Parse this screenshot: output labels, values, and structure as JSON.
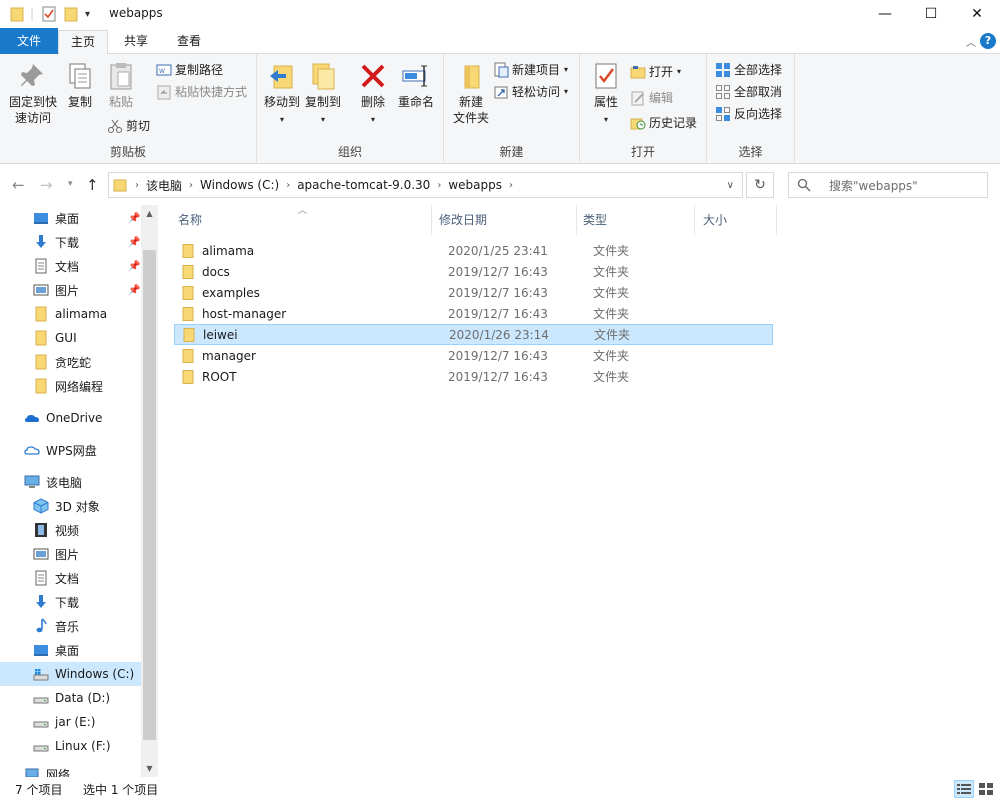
{
  "window": {
    "title": "webapps",
    "minimize": "—",
    "maximize": "☐",
    "close": "✕"
  },
  "ribbon_tabs": {
    "file": "文件",
    "home": "主页",
    "share": "共享",
    "view": "查看",
    "help": "?"
  },
  "clipboard": {
    "pin": "固定到快\n速访问",
    "pin_line1": "固定到快",
    "pin_line2": "速访问",
    "copy": "复制",
    "paste": "粘贴",
    "copy_path": "复制路径",
    "paste_shortcut": "粘贴快捷方式",
    "cut": "剪切",
    "label": "剪贴板"
  },
  "organize": {
    "move_to": "移动到",
    "copy_to": "复制到",
    "delete": "删除",
    "rename": "重命名",
    "label": "组织"
  },
  "new_group": {
    "new_folder_line1": "新建",
    "new_folder_line2": "文件夹",
    "new_item": "新建项目",
    "easy_access": "轻松访问",
    "label": "新建"
  },
  "open_group": {
    "properties": "属性",
    "open": "打开",
    "edit": "编辑",
    "history": "历史记录",
    "label": "打开"
  },
  "select_group": {
    "select_all": "全部选择",
    "select_none": "全部取消",
    "invert": "反向选择",
    "label": "选择"
  },
  "address": {
    "crumbs": [
      "该电脑",
      "Windows (C:)",
      "apache-tomcat-9.0.30",
      "webapps"
    ],
    "search_placeholder": "搜索\"webapps\""
  },
  "nav": {
    "quick": [
      {
        "label": "桌面",
        "pinned": true
      },
      {
        "label": "下载",
        "pinned": true
      },
      {
        "label": "文档",
        "pinned": true
      },
      {
        "label": "图片",
        "pinned": true
      },
      {
        "label": "alimama"
      },
      {
        "label": "GUI"
      },
      {
        "label": "贪吃蛇"
      },
      {
        "label": "网络编程"
      }
    ],
    "onedrive": "OneDrive",
    "wps": "WPS网盘",
    "this_pc": "该电脑",
    "pc_items": [
      "3D 对象",
      "视频",
      "图片",
      "文档",
      "下载",
      "音乐",
      "桌面",
      "Windows (C:)",
      "Data (D:)",
      "jar (E:)",
      "Linux (F:)"
    ],
    "network": "网络"
  },
  "columns": {
    "name": "名称",
    "date": "修改日期",
    "type": "类型",
    "size": "大小"
  },
  "files": [
    {
      "name": "alimama",
      "date": "2020/1/25 23:41",
      "type": "文件夹"
    },
    {
      "name": "docs",
      "date": "2019/12/7 16:43",
      "type": "文件夹"
    },
    {
      "name": "examples",
      "date": "2019/12/7 16:43",
      "type": "文件夹"
    },
    {
      "name": "host-manager",
      "date": "2019/12/7 16:43",
      "type": "文件夹"
    },
    {
      "name": "leiwei",
      "date": "2020/1/26 23:14",
      "type": "文件夹"
    },
    {
      "name": "manager",
      "date": "2019/12/7 16:43",
      "type": "文件夹"
    },
    {
      "name": "ROOT",
      "date": "2019/12/7 16:43",
      "type": "文件夹"
    }
  ],
  "status": {
    "count": "7 个项目",
    "selected": "选中 1 个项目"
  },
  "colors": {
    "accent": "#1979ca",
    "selection": "#cce8ff",
    "folder": "#f8d775"
  }
}
